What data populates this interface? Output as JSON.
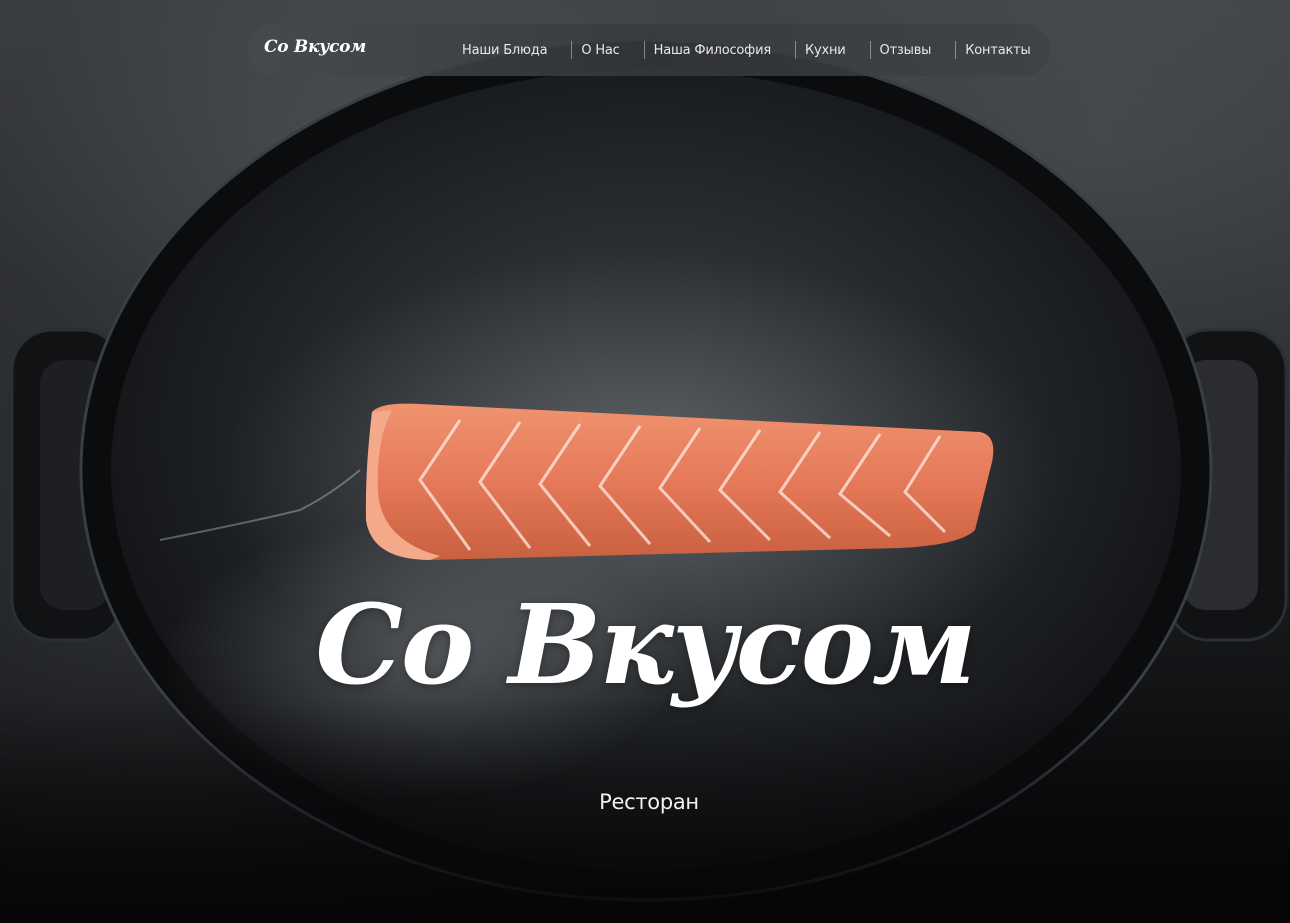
{
  "brand": {
    "logo_text": "Со Вкусом"
  },
  "nav": {
    "items": [
      {
        "label": "Наши Блюда"
      },
      {
        "label": "О Нас"
      },
      {
        "label": "Наша Философия"
      },
      {
        "label": "Кухни"
      },
      {
        "label": "Отзывы"
      },
      {
        "label": "Контакты"
      }
    ]
  },
  "hero": {
    "title": "Со Вкусом",
    "subtitle": "Ресторан",
    "image_subject": "salmon-fillet-in-cast-iron-pan",
    "colors": {
      "background": "#1e2023",
      "pan": "#0e0f11",
      "salmon": "#e5795a",
      "text": "#ffffff"
    }
  }
}
